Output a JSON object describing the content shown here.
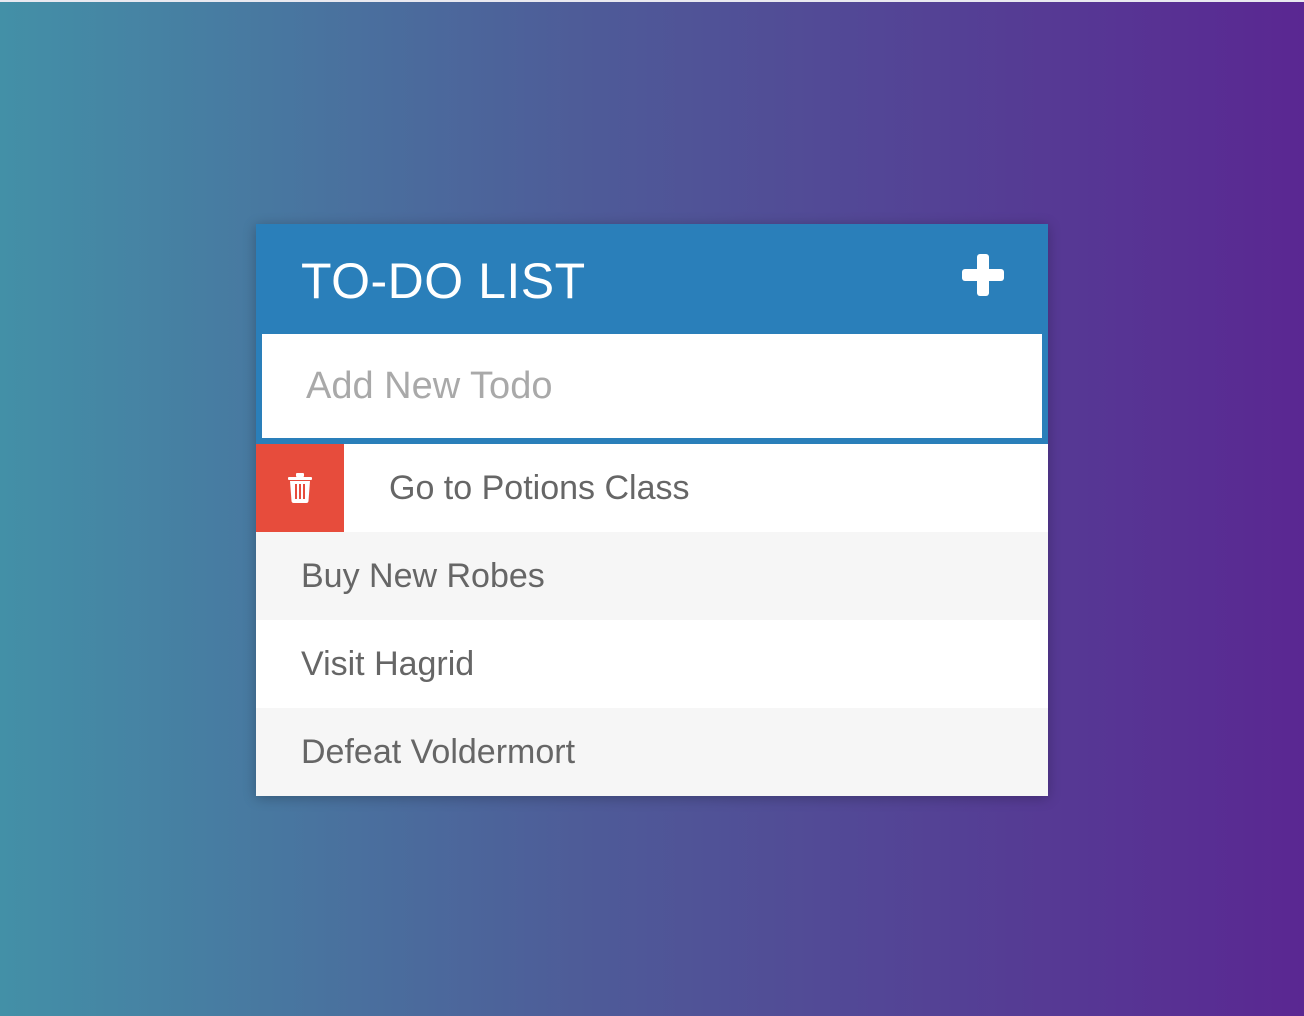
{
  "header": {
    "title": "TO-DO LIST",
    "add_icon": "plus-icon"
  },
  "input": {
    "placeholder": "Add New Todo",
    "value": ""
  },
  "todos": [
    {
      "text": "Go to Potions Class",
      "delete_icon": "trash-icon",
      "delete_visible": true
    },
    {
      "text": "Buy New Robes"
    },
    {
      "text": "Visit Hagrid"
    },
    {
      "text": "Defeat Voldermort"
    }
  ],
  "colors": {
    "header": "#2a7fba",
    "delete": "#e74c3c",
    "gradient_start": "#4390a7",
    "gradient_end": "#5a2792"
  }
}
